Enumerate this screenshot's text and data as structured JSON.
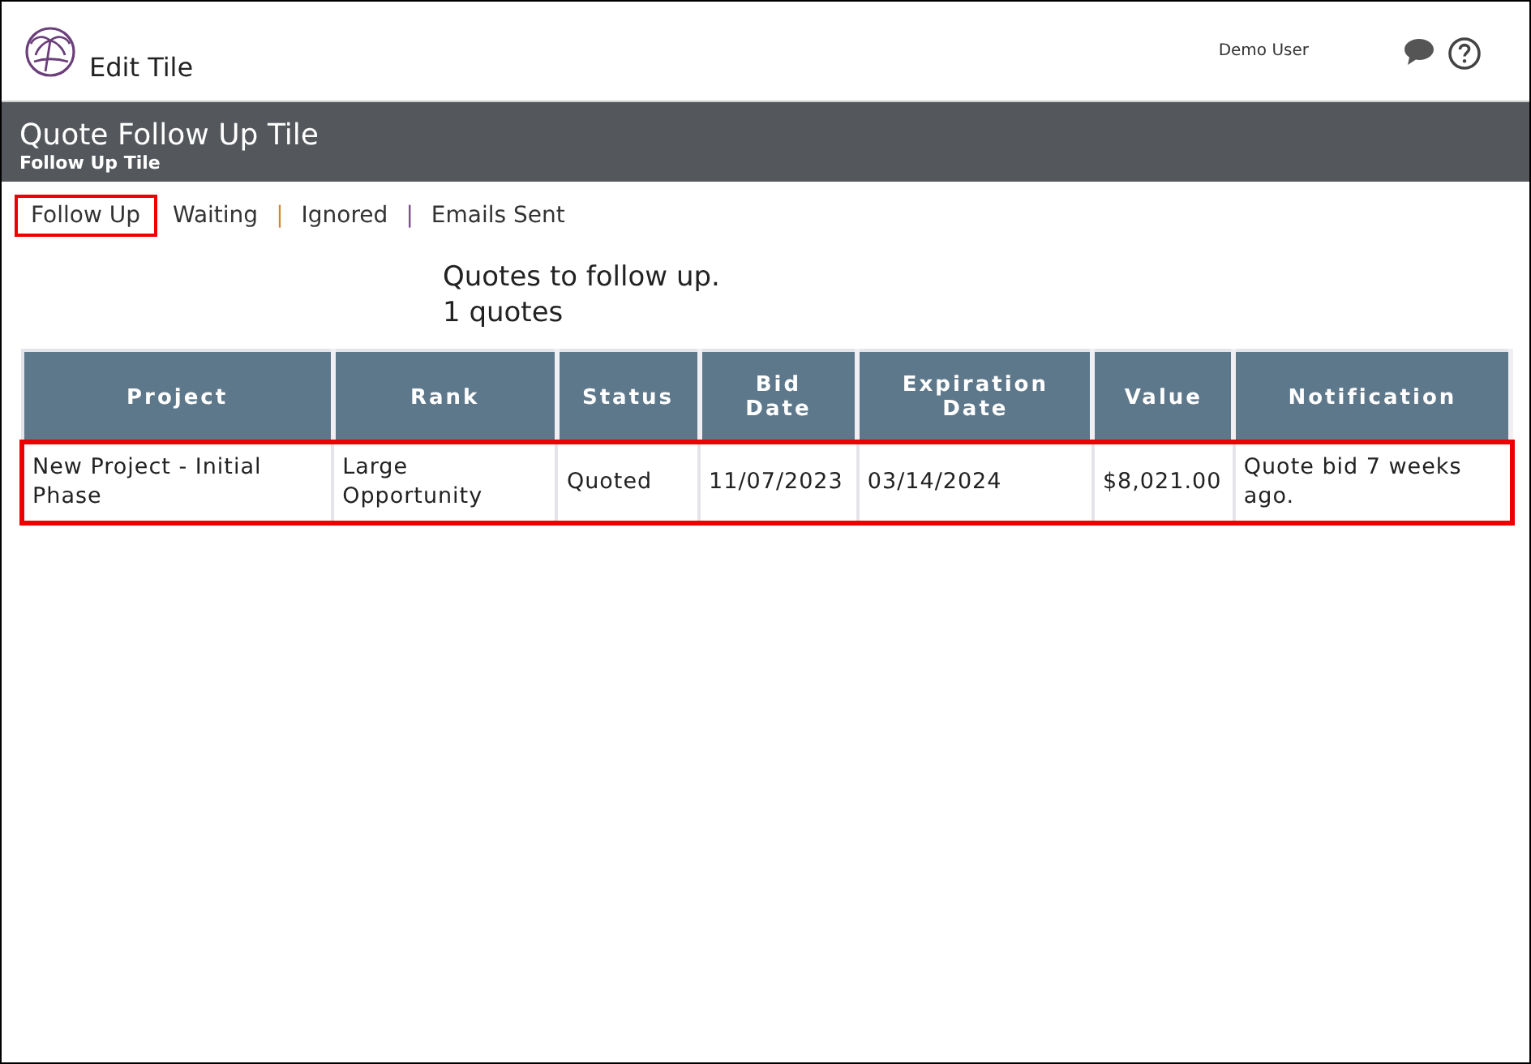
{
  "header": {
    "title": "Edit Tile",
    "user": "Demo User"
  },
  "banner": {
    "title": "Quote Follow Up Tile",
    "subtitle": "Follow Up Tile"
  },
  "tabs": [
    {
      "label": "Follow Up",
      "selected": true
    },
    {
      "label": "Waiting",
      "selected": false
    },
    {
      "label": "Ignored",
      "selected": false,
      "separator": {
        "text": "|",
        "color": "#d08a2a"
      }
    },
    {
      "label": "Emails Sent",
      "selected": false,
      "separator": {
        "text": "|",
        "color": "#7a4a8a"
      }
    }
  ],
  "summary": {
    "heading": "Quotes to follow up.",
    "count": "1 quotes"
  },
  "table": {
    "columns": [
      "Project",
      "Rank",
      "Status",
      "Bid Date",
      "Expiration Date",
      "Value",
      "Notification"
    ],
    "rows": [
      {
        "highlighted": true,
        "cells": [
          "New Project - Initial Phase",
          "Large Opportunity",
          "Quoted",
          "11/07/2023",
          "03/14/2024",
          "$8,021.00",
          "Quote bid 7 weeks ago."
        ]
      }
    ]
  }
}
